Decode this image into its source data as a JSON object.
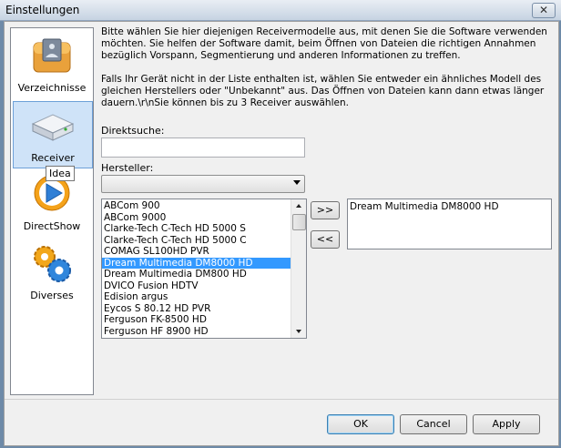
{
  "window": {
    "title": "Einstellungen"
  },
  "sidebar": {
    "items": [
      {
        "label": "Verzeichnisse",
        "icon": "folder-icon"
      },
      {
        "label": "Receiver",
        "icon": "receiver-icon",
        "selected": true
      },
      {
        "label": "DirectShow",
        "icon": "play-icon"
      },
      {
        "label": "Diverses",
        "icon": "gears-icon"
      }
    ],
    "tooltip": "Idea"
  },
  "main": {
    "description_1": "Bitte wählen Sie hier diejenigen Receivermodelle aus, mit denen Sie die Software verwenden möchten. Sie helfen der Software damit, beim Öffnen von Dateien die richtigen Annahmen bezüglich Vorspann, Segmentierung und anderen Informationen zu treffen.",
    "description_2": "Falls Ihr Gerät nicht in der Liste enthalten ist, wählen Sie entweder ein ähnliches Modell des gleichen Herstellers oder \"Unbekannt\" aus. Das Öffnen von Dateien kann dann etwas länger dauern.\\r\\nSie können bis zu 3 Receiver auswählen.",
    "search_label": "Direktsuche:",
    "search_value": "",
    "manufacturer_label": "Hersteller:",
    "manufacturer_value": "",
    "available_models": [
      "ABCom 900",
      "ABCom 9000",
      "Clarke-Tech C-Tech HD 5000 S",
      "Clarke-Tech C-Tech HD 5000 C",
      "COMAG SL100HD PVR",
      "Dream Multimedia DM8000 HD",
      "Dream Multimedia DM800 HD",
      "DVICO Fusion HDTV",
      "Edision argus",
      "Eycos S 80.12 HD PVR",
      "Ferguson FK-8500 HD",
      "Ferguson HF 8900 HD"
    ],
    "selected_available_index": 5,
    "add_label": ">>",
    "remove_label": "<<",
    "chosen_models": [
      "Dream Multimedia DM8000 HD"
    ]
  },
  "footer": {
    "ok_label": "OK",
    "cancel_label": "Cancel",
    "apply_label": "Apply"
  },
  "colors": {
    "selection": "#3399ff",
    "sidebar_selected": "#cfe3f8"
  }
}
